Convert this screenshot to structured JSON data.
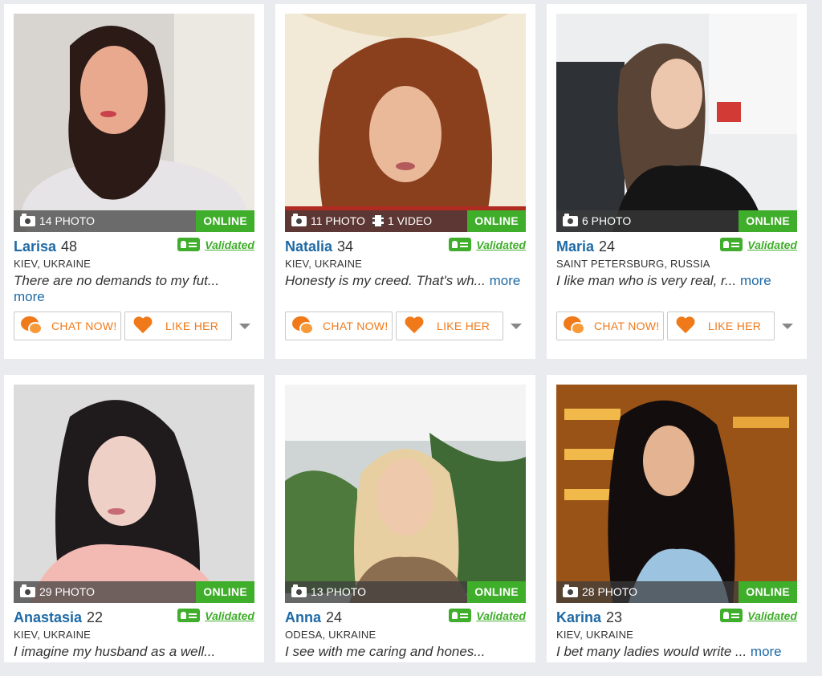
{
  "online_label": "ONLINE",
  "validated_label": "Validated",
  "more_label": "more",
  "chat_label": "CHAT NOW!",
  "like_label": "LIKE HER",
  "colors": {
    "name_blue": "#1e6aa6",
    "online_green": "#3fae2a",
    "accent_orange": "#f07a1a"
  },
  "profiles": [
    {
      "name": "Larisa",
      "age": "48",
      "photos": "14 PHOTO",
      "videos": "",
      "location": "KIEV, UKRAINE",
      "bio": "There are no demands to my fut...",
      "bio_more_newline": true
    },
    {
      "name": "Natalia",
      "age": "34",
      "photos": "11 PHOTO",
      "videos": "1 VIDEO",
      "location": "KIEV, UKRAINE",
      "bio": "Honesty is my creed. That's wh...",
      "bio_more_newline": false
    },
    {
      "name": "Maria",
      "age": "24",
      "photos": "6 PHOTO",
      "videos": "",
      "location": "SAINT PETERSBURG, RUSSIA",
      "bio": "I like man who is very real, r...",
      "bio_more_newline": false
    },
    {
      "name": "Anastasia",
      "age": "22",
      "photos": "29 PHOTO",
      "videos": "",
      "location": "KIEV, UKRAINE",
      "bio": "I imagine my husband as a well...",
      "bio_more_newline": true
    },
    {
      "name": "Anna",
      "age": "24",
      "photos": "13 PHOTO",
      "videos": "",
      "location": "ODESA, UKRAINE",
      "bio": "I see with me caring and hones...",
      "bio_more_newline": true
    },
    {
      "name": "Karina",
      "age": "23",
      "photos": "28 PHOTO",
      "videos": "",
      "location": "KIEV, UKRAINE",
      "bio": "I bet many ladies would write ...",
      "bio_more_newline": false
    }
  ]
}
